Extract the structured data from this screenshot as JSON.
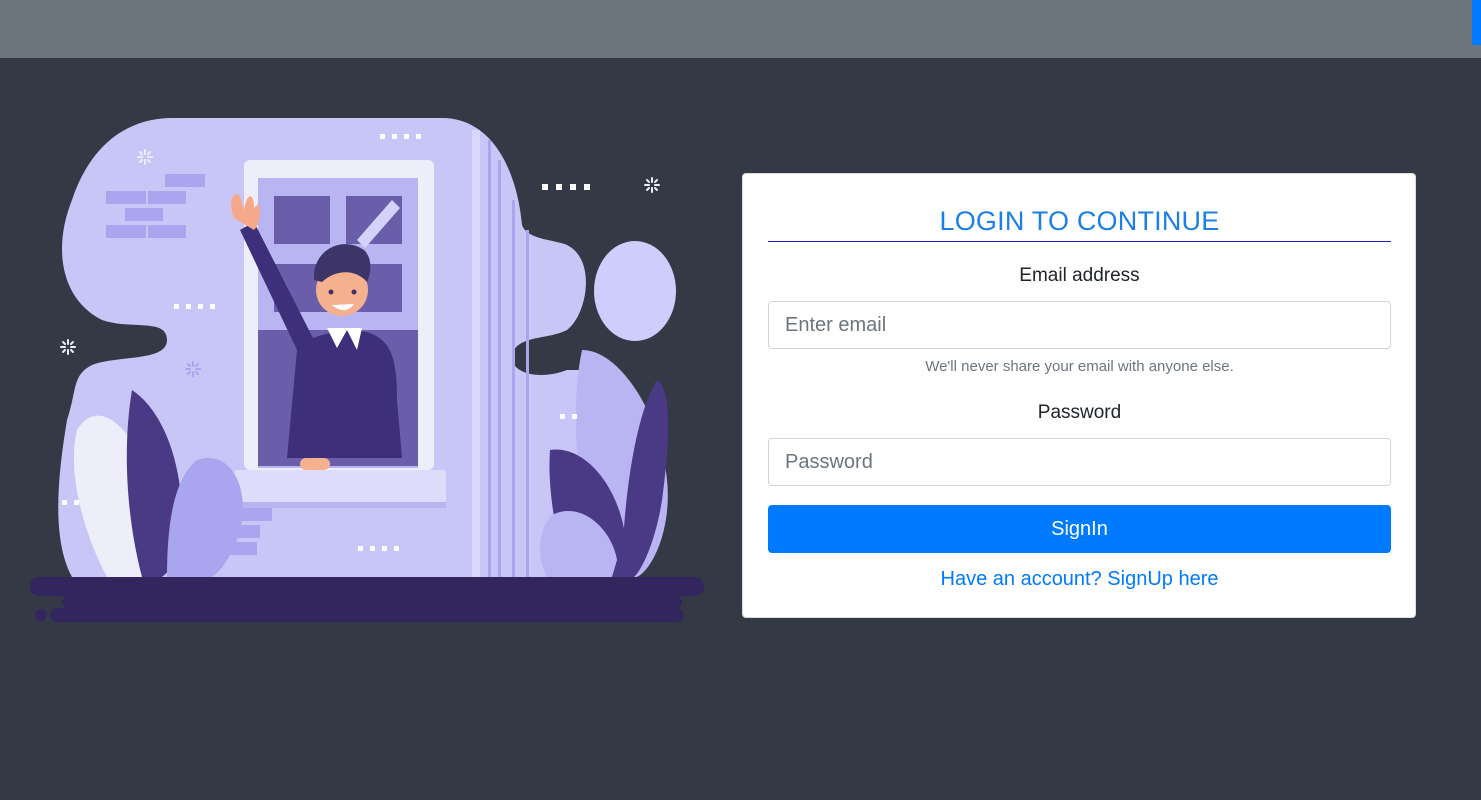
{
  "login": {
    "title": "LOGIN TO CONTINUE",
    "email_label": "Email address",
    "email_placeholder": "Enter email",
    "email_value": "",
    "email_help": "We'll never share your email with anyone else.",
    "password_label": "Password",
    "password_placeholder": "Password",
    "password_value": "",
    "signin_label": "SignIn",
    "signup_link": "Have an account? SignUp here"
  },
  "colors": {
    "page_background": "#343a45",
    "topbar": "#6c757d",
    "accent": "#007bff",
    "illustration_primary": "#c8c6f7",
    "illustration_dark": "#33265e"
  },
  "icons": {
    "illustration": "waving-person-in-window-illustration"
  }
}
